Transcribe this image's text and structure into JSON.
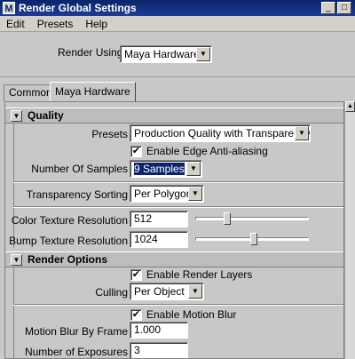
{
  "window": {
    "title": "Render Global Settings",
    "app_icon": "M"
  },
  "window_controls": [
    {
      "name": "minimize",
      "glyph": "_"
    },
    {
      "name": "maximize",
      "glyph": "□"
    }
  ],
  "menu": [
    "Edit",
    "Presets",
    "Help"
  ],
  "render_using": {
    "label": "Render Using",
    "value": "Maya Hardware"
  },
  "tabs": [
    {
      "label": "Common",
      "active": false
    },
    {
      "label": "Maya Hardware",
      "active": true
    }
  ],
  "quality": {
    "title": "Quality",
    "presets_label": "Presets",
    "presets_value": "Production Quality with Transparency",
    "edge_aa_label": "Enable Edge Anti-aliasing",
    "edge_aa_checked": true,
    "samples_label": "Number Of Samples",
    "samples_value": "9 Samples",
    "transparency_label": "Transparency Sorting",
    "transparency_value": "Per Polygon",
    "color_tex_label": "Color Texture Resolution",
    "color_tex_value": "512",
    "color_tex_slider": 0.27,
    "bump_tex_label": "Bump Texture Resolution",
    "bump_tex_value": "1024",
    "bump_tex_slider": 0.52
  },
  "render_options": {
    "title": "Render Options",
    "render_layers_label": "Enable Render Layers",
    "render_layers_checked": true,
    "culling_label": "Culling",
    "culling_value": "Per Object",
    "motion_blur_label": "Enable Motion Blur",
    "motion_blur_checked": true,
    "mb_frame_label": "Motion Blur By Frame",
    "mb_frame_value": "1.000",
    "exposures_label": "Number of Exposures",
    "exposures_value": "3"
  },
  "icons": {
    "collapse": "collapse-triangle-icon",
    "dropdown": "chevron-down-icon",
    "check": "check-icon",
    "scroll_up": "scroll-up-arrow-icon"
  }
}
